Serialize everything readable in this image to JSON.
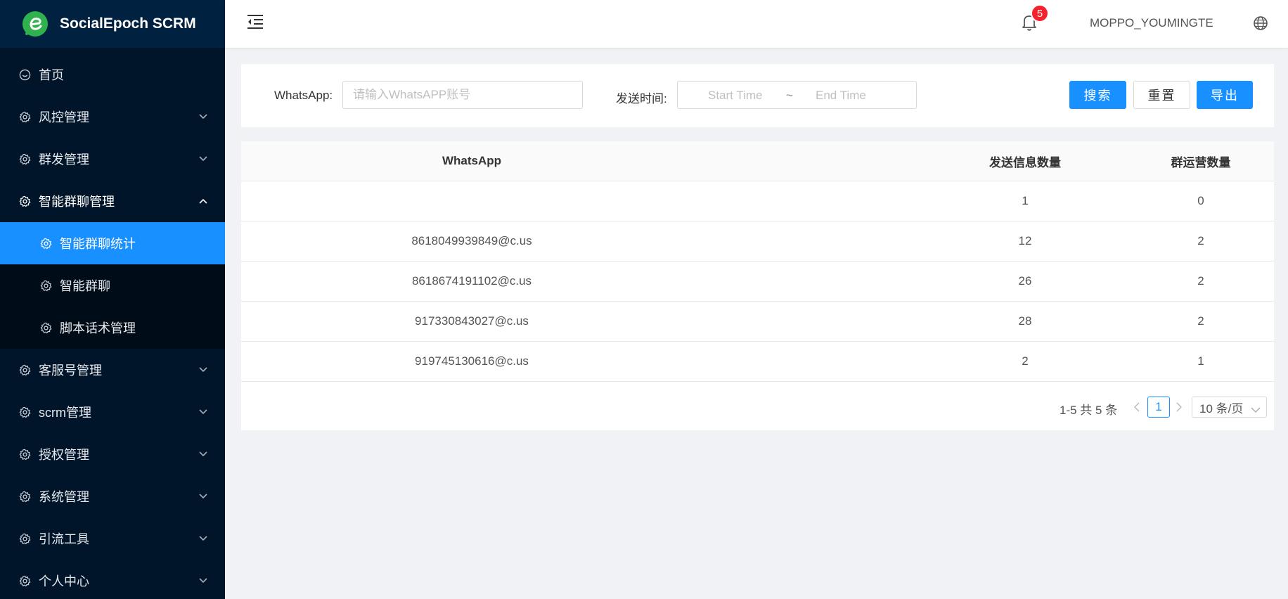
{
  "app": {
    "title": "SocialEpoch SCRM",
    "brand_color": "#1890ff",
    "sidebar_bg": "#001529",
    "logo_color": "#2fb24d"
  },
  "sidebar": {
    "items": [
      {
        "label": "首页",
        "icon": "home-icon"
      },
      {
        "label": "风控管理",
        "icon": "gear-icon"
      },
      {
        "label": "群发管理",
        "icon": "gear-icon"
      },
      {
        "label": "智能群聊管理",
        "icon": "gear-icon",
        "expanded": true,
        "children": [
          {
            "label": "智能群聊统计",
            "icon": "gear-icon",
            "active": true
          },
          {
            "label": "智能群聊",
            "icon": "gear-icon"
          },
          {
            "label": "脚本话术管理",
            "icon": "gear-icon"
          }
        ]
      },
      {
        "label": "客服号管理",
        "icon": "gear-icon"
      },
      {
        "label": "scrm管理",
        "icon": "gear-icon"
      },
      {
        "label": "授权管理",
        "icon": "gear-icon"
      },
      {
        "label": "系统管理",
        "icon": "gear-icon"
      },
      {
        "label": "引流工具",
        "icon": "gear-icon"
      },
      {
        "label": "个人中心",
        "icon": "gear-icon"
      }
    ]
  },
  "header": {
    "notification_count": "5",
    "username": "MOPPO_YOUMINGTE",
    "badge_color": "#f5222d"
  },
  "filters": {
    "whatsapp_label": "WhatsApp:",
    "whatsapp_placeholder": "请输入WhatsAPP账号",
    "whatsapp_value": "",
    "time_label": "发送时间:",
    "start_placeholder": "Start Time",
    "separator": "~",
    "end_placeholder": "End Time",
    "search_label": "搜索",
    "reset_label": "重置",
    "export_label": "导出"
  },
  "table": {
    "columns": [
      "WhatsApp",
      "发送信息数量",
      "群运营数量"
    ],
    "rows": [
      [
        "",
        "1",
        "0"
      ],
      [
        "8618049939849@c.us",
        "12",
        "2"
      ],
      [
        "8618674191102@c.us",
        "26",
        "2"
      ],
      [
        "917330843027@c.us",
        "28",
        "2"
      ],
      [
        "919745130616@c.us",
        "2",
        "1"
      ]
    ]
  },
  "pagination": {
    "total_text": "1-5 共 5 条",
    "current_page": "1",
    "page_size": "10 条/页"
  }
}
